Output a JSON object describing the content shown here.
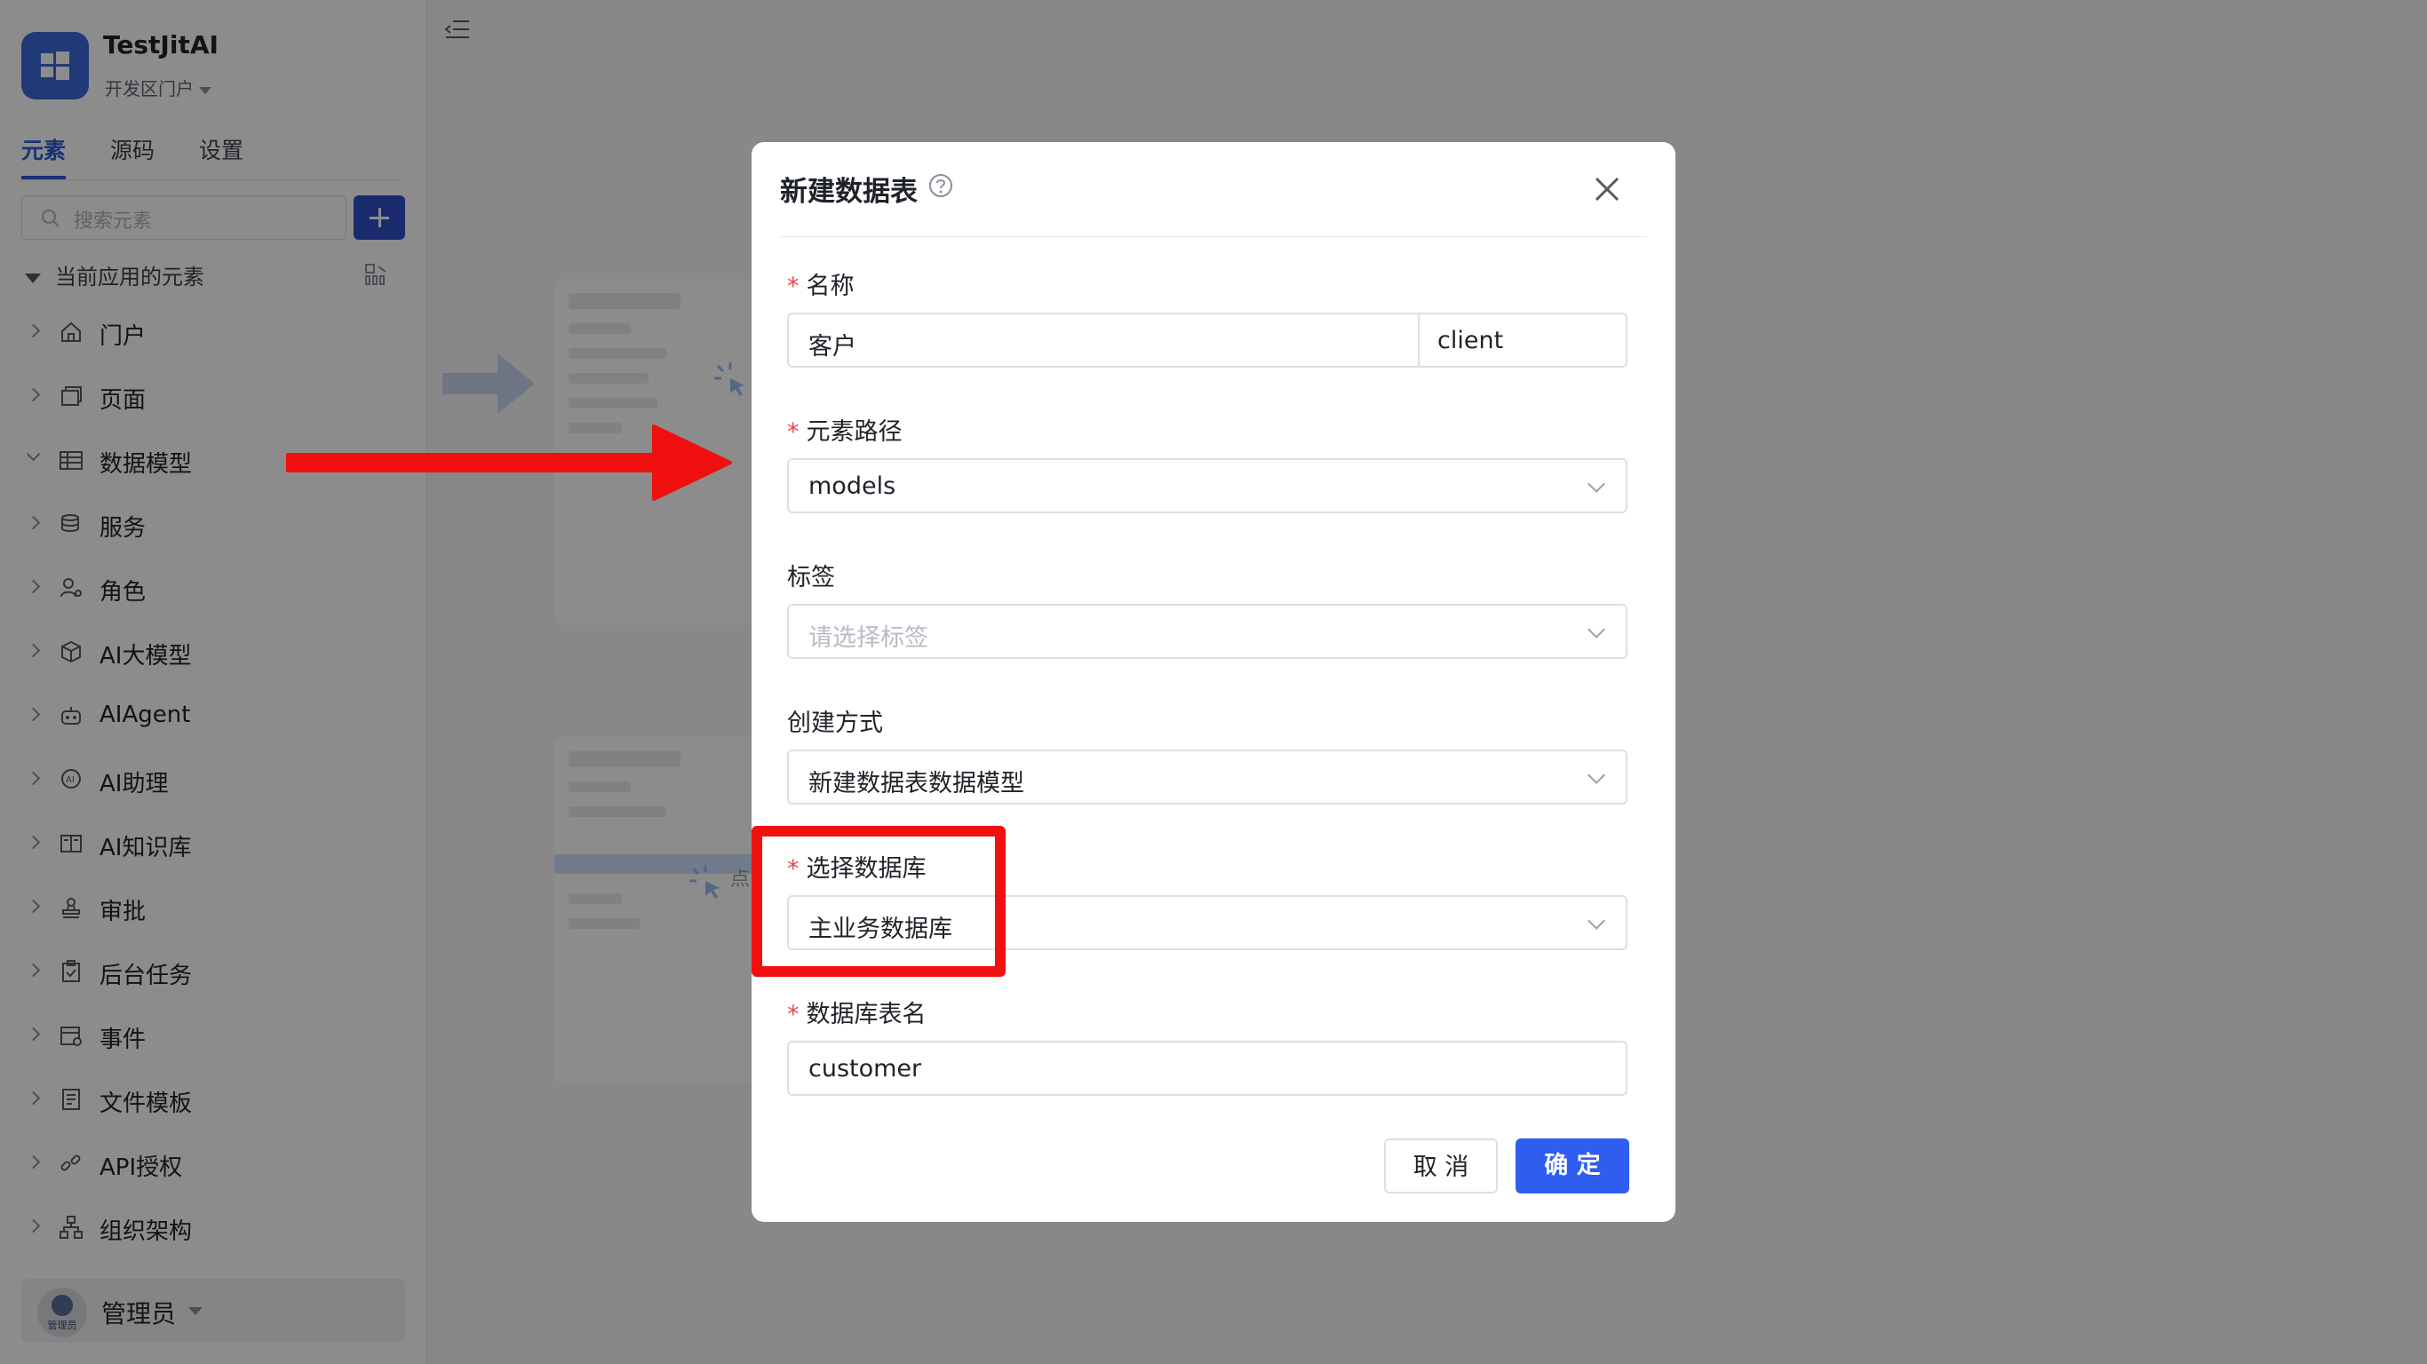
{
  "app": {
    "name": "TestJitAI",
    "subtitle": "开发区门户"
  },
  "tabs": [
    {
      "label": "元素",
      "active": true
    },
    {
      "label": "源码",
      "active": false
    },
    {
      "label": "设置",
      "active": false
    }
  ],
  "search": {
    "placeholder": "搜索元素"
  },
  "section": {
    "label": "当前应用的元素"
  },
  "nav": [
    {
      "label": "门户",
      "icon": "home-icon",
      "expanded": false
    },
    {
      "label": "页面",
      "icon": "page-icon",
      "expanded": false
    },
    {
      "label": "数据模型",
      "icon": "table-icon",
      "expanded": true
    },
    {
      "label": "服务",
      "icon": "database-icon",
      "expanded": false
    },
    {
      "label": "角色",
      "icon": "role-icon",
      "expanded": false
    },
    {
      "label": "AI大模型",
      "icon": "cube-icon",
      "expanded": false
    },
    {
      "label": "AIAgent",
      "icon": "robot-icon",
      "expanded": false
    },
    {
      "label": "AI助理",
      "icon": "ai-assistant-icon",
      "expanded": false
    },
    {
      "label": "AI知识库",
      "icon": "book-icon",
      "expanded": false
    },
    {
      "label": "审批",
      "icon": "stamp-icon",
      "expanded": false
    },
    {
      "label": "后台任务",
      "icon": "clipboard-icon",
      "expanded": false
    },
    {
      "label": "事件",
      "icon": "calendar-icon",
      "expanded": false
    },
    {
      "label": "文件模板",
      "icon": "document-icon",
      "expanded": false
    },
    {
      "label": "API授权",
      "icon": "link-icon",
      "expanded": false
    },
    {
      "label": "组织架构",
      "icon": "org-chart-icon",
      "expanded": false
    }
  ],
  "user": {
    "name": "管理员",
    "avatar_text": "管理员"
  },
  "background": {
    "click_hint": "点"
  },
  "modal": {
    "title": "新建数据表",
    "fields": {
      "name": {
        "label": "名称",
        "required": true,
        "value": "客户",
        "value2": "client"
      },
      "path": {
        "label": "元素路径",
        "required": true,
        "value": "models"
      },
      "tags": {
        "label": "标签",
        "required": false,
        "placeholder": "请选择标签"
      },
      "method": {
        "label": "创建方式",
        "required": false,
        "value": "新建数据表数据模型"
      },
      "database": {
        "label": "选择数据库",
        "required": true,
        "value": "主业务数据库"
      },
      "table_name": {
        "label": "数据库表名",
        "required": true,
        "value": "customer"
      }
    },
    "buttons": {
      "cancel": "取 消",
      "ok": "确 定"
    }
  },
  "colors": {
    "primary": "#2e5df0",
    "annotation": "#f01010",
    "required": "#e5484d"
  }
}
